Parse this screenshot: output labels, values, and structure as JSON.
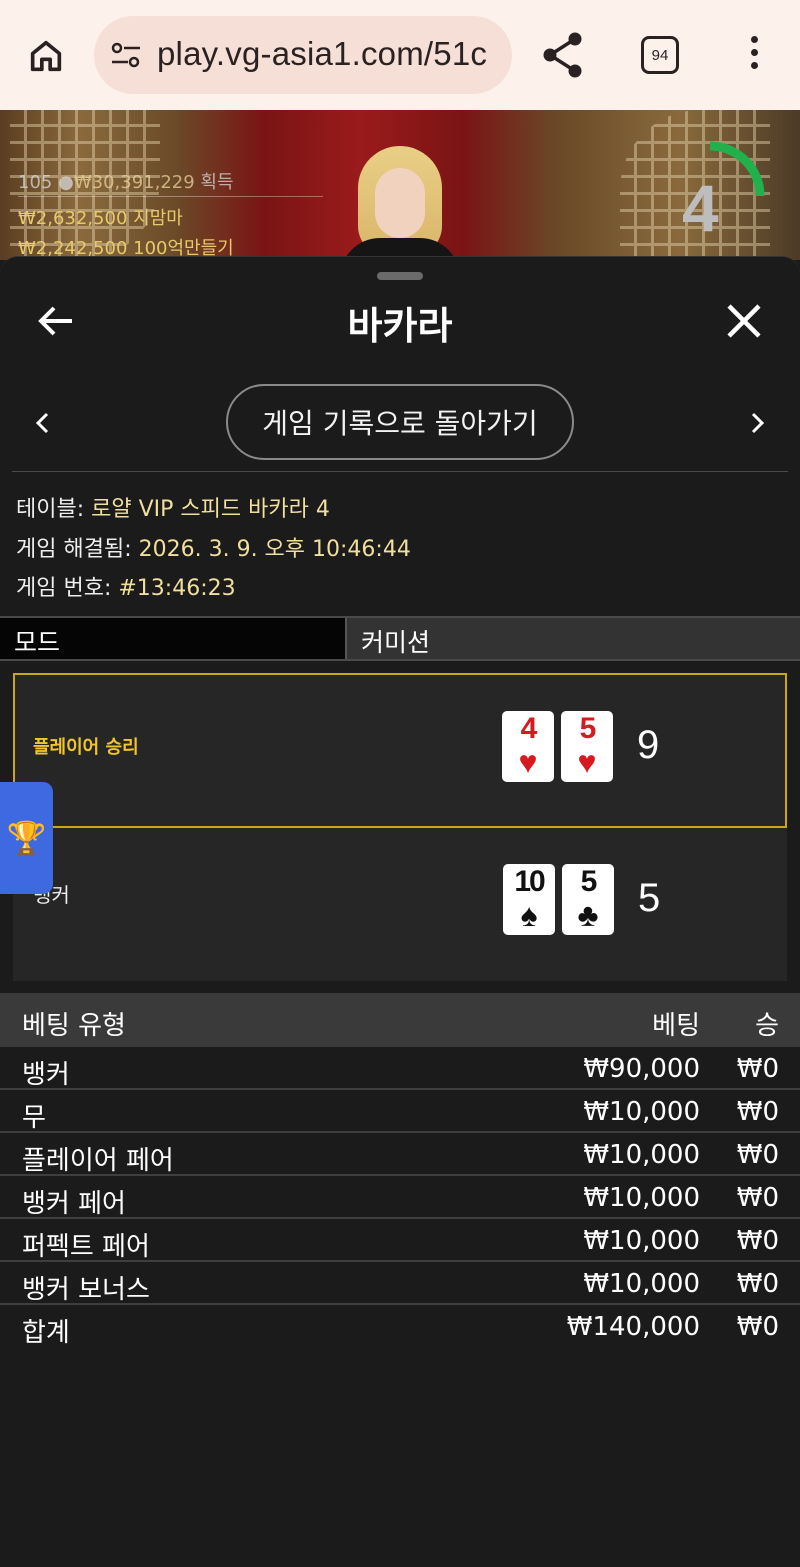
{
  "browser": {
    "url": "play.vg-asia1.com/51c",
    "tab_count": "94",
    "icons": [
      "home-icon",
      "tune-icon",
      "share-icon",
      "tab-switcher-icon",
      "more-vert-icon"
    ]
  },
  "video": {
    "players": "105",
    "total": "₩30,391,229",
    "total_suffix": "획득",
    "winner1": "₩2,632,500  지맘마",
    "winner2": "₩2,242,500  100억만들기",
    "timer": "4"
  },
  "sheet": {
    "title": "바카라",
    "return_label": "게임 기록으로 돌아가기"
  },
  "info": {
    "table_label": "테이블: ",
    "table_value": "로얄 VIP 스피드 바카라 4",
    "resolved_label": "게임 해결됨: ",
    "resolved_value": "2026. 3. 9. 오후 10:46:44",
    "game_no_label": "게임 번호: ",
    "game_no_value": "#13:46:23"
  },
  "tabs": {
    "mode": "모드",
    "commission": "커미션"
  },
  "result": {
    "player": {
      "label": "플레이어 승리",
      "cards": [
        {
          "rank": "4",
          "suit": "♥"
        },
        {
          "rank": "5",
          "suit": "♥"
        }
      ],
      "total": "9"
    },
    "banker": {
      "label": "뱅커",
      "cards": [
        {
          "rank": "10",
          "suit": "♠"
        },
        {
          "rank": "5",
          "suit": "♣"
        }
      ],
      "total": "5"
    }
  },
  "bets": {
    "headers": {
      "type": "베팅 유형",
      "bet": "베팅",
      "win": "승"
    },
    "rows": [
      {
        "type": "뱅커",
        "bet": "₩90,000",
        "win": "₩0"
      },
      {
        "type": "무",
        "bet": "₩10,000",
        "win": "₩0"
      },
      {
        "type": "플레이어 페어",
        "bet": "₩10,000",
        "win": "₩0"
      },
      {
        "type": "뱅커 페어",
        "bet": "₩10,000",
        "win": "₩0"
      },
      {
        "type": "퍼펙트 페어",
        "bet": "₩10,000",
        "win": "₩0"
      },
      {
        "type": "뱅커 보너스",
        "bet": "₩10,000",
        "win": "₩0"
      }
    ],
    "total": {
      "type": "합계",
      "bet": "₩140,000",
      "win": "₩0"
    }
  },
  "colors": {
    "accent_gold": "#c8a71c",
    "card_red": "#d71920",
    "timer_green": "#21b14c",
    "trophy_tab_blue": "#3e69e0"
  }
}
